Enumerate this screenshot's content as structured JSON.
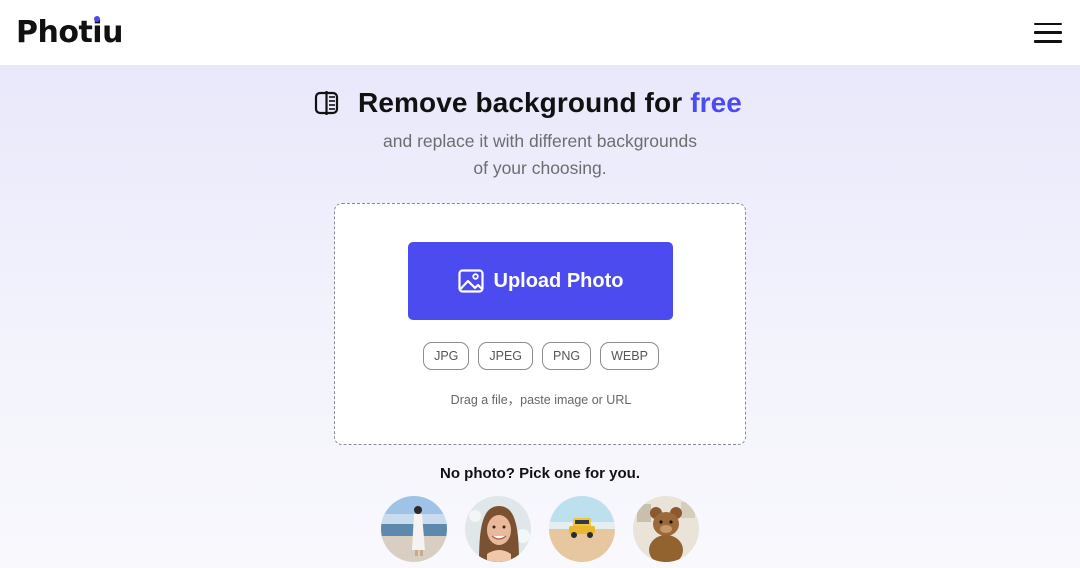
{
  "header": {
    "logo_prefix": "Phot",
    "logo_i": "i",
    "logo_suffix": "u",
    "logo_dot_color": "#4b4bf0",
    "menu_icon": "hamburger-menu-icon"
  },
  "hero": {
    "title_icon": "compare-split-icon",
    "title_main": "Remove background for",
    "title_accent": "free",
    "accent_color": "#4b4bf0",
    "subtitle_line1": "and replace it with different backgrounds",
    "subtitle_line2": "of your choosing."
  },
  "upload": {
    "button_icon": "image-icon",
    "button_label": "Upload Photo",
    "button_color": "#4b4bf0",
    "formats": [
      "JPG",
      "JPEG",
      "PNG",
      "WEBP"
    ],
    "drag_hint": "Drag a file，paste image or URL"
  },
  "samples": {
    "prompt": "No photo? Pick one for you.",
    "items": [
      {
        "name": "woman-at-beach"
      },
      {
        "name": "smiling-woman-portrait"
      },
      {
        "name": "car-on-beach"
      },
      {
        "name": "teddy-bear"
      }
    ]
  }
}
